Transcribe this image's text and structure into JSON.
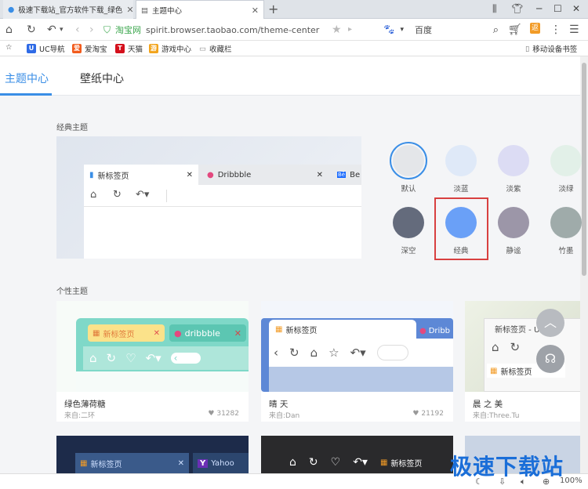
{
  "browser": {
    "tabs": [
      {
        "title": "极速下载站_官方软件下载_绿色"
      },
      {
        "title": "主题中心"
      }
    ],
    "new_tab_symbol": "+",
    "url": "spirit.browser.taobao.com/theme-center",
    "site_badge": "淘宝网",
    "search_engine": "百度",
    "bookmarks": [
      "UC导航",
      "爱淘宝",
      "天猫",
      "游戏中心",
      "收藏栏"
    ],
    "sync_bookmarks": "移动设备书签",
    "zoom": "100%"
  },
  "page": {
    "tabs": [
      "主题中心",
      "壁纸中心"
    ],
    "active_tab": "主题中心",
    "classic_title": "经典主题",
    "personal_title": "个性主题",
    "preview": {
      "tab1": "新标签页",
      "tab2": "Dribbble",
      "tab3": "Be"
    },
    "swatches": [
      {
        "label": "默认",
        "color": "#e4e6e9"
      },
      {
        "label": "淡蓝",
        "color": "#dfe9f8"
      },
      {
        "label": "淡紫",
        "color": "#dcdcf4"
      },
      {
        "label": "淡绿",
        "color": "#e2f0e8"
      },
      {
        "label": "深空",
        "color": "#646b7c"
      },
      {
        "label": "经典",
        "color": "#6aa0f7"
      },
      {
        "label": "静谧",
        "color": "#9c96a8"
      },
      {
        "label": "竹墨",
        "color": "#9fabaa"
      }
    ],
    "selected_swatch": "默认",
    "highlighted_swatch": "经典",
    "cards": [
      {
        "name": "绿色薄荷糖",
        "source": "来自:二环",
        "likes": "31282",
        "tab_a": "新标签页",
        "tab_b": "dribbble"
      },
      {
        "name": "晴 天",
        "source": "来自:Dan",
        "likes": "21192",
        "tab_a": "新标签页",
        "tab_b": "Dribb"
      },
      {
        "name": "晨 之 美",
        "source": "来自:Three.Tu",
        "likes": "",
        "tab_a": "新标签页 - U",
        "tab_b": "新标签页"
      }
    ],
    "bottom_cards": {
      "card1_tab_a": "新标签页",
      "card1_tab_b": "Yahoo",
      "card2_tab": "新标签页"
    }
  },
  "watermark": "极速下载站"
}
